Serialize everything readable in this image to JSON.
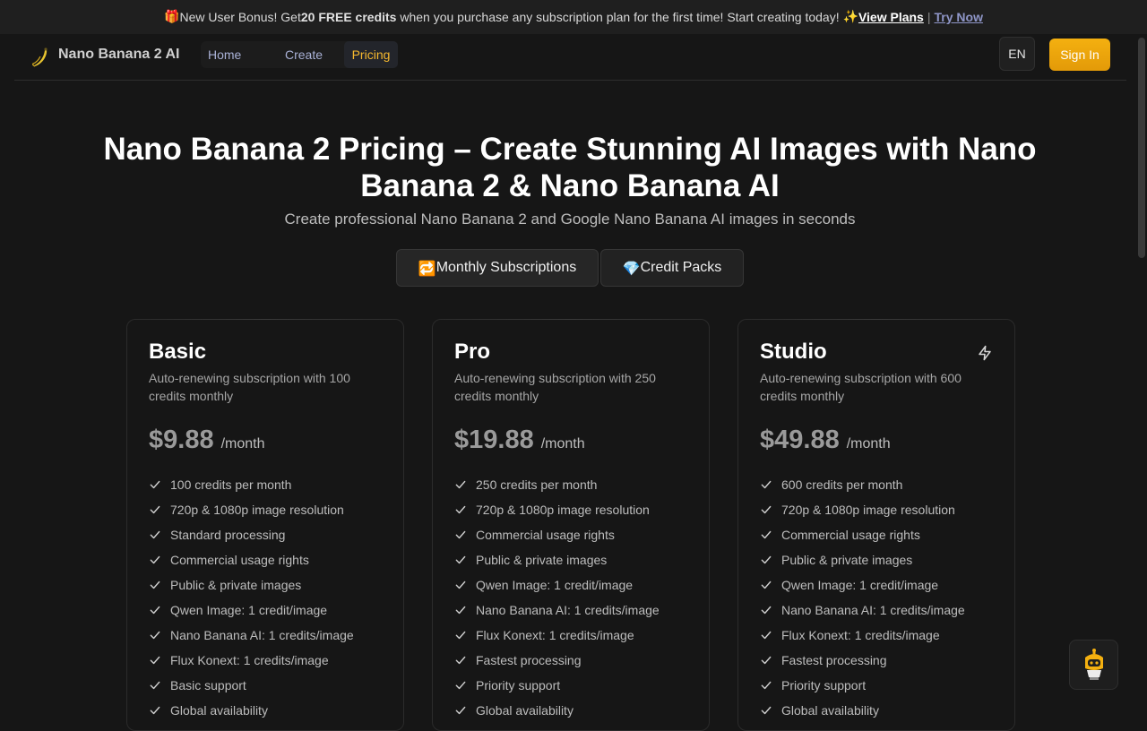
{
  "banner": {
    "gift_emoji": "🎁",
    "text_before": "New User Bonus! Get ",
    "bold_credits": "20 FREE credits",
    "text_after": " when you purchase any subscription plan for the first time! Start creating today! ",
    "sparkle_emoji": "✨",
    "view_plans": "View Plans",
    "separator": "|",
    "try_now": "Try Now"
  },
  "nav": {
    "brand": "Nano Banana 2 AI",
    "items": [
      {
        "label": "Home",
        "active": false
      },
      {
        "label": "Create",
        "active": false
      },
      {
        "label": "Pricing",
        "active": true
      }
    ],
    "lang": "EN",
    "signin": "Sign In"
  },
  "hero": {
    "title": "Nano Banana 2 Pricing – Create Stunning AI Images with Nano Banana 2 & Nano Banana AI",
    "subtitle": "Create professional Nano Banana 2 and Google Nano Banana AI images in seconds"
  },
  "tabs": [
    {
      "emoji": "🔁",
      "label": "Monthly Subscriptions",
      "active": true
    },
    {
      "emoji": "💎",
      "label": "Credit Packs",
      "active": false
    }
  ],
  "plans": [
    {
      "name": "Basic",
      "desc": "Auto-renewing subscription with 100 credits monthly",
      "price": "$9.88",
      "period": "/month",
      "features": [
        "100 credits per month",
        "720p & 1080p image resolution",
        "Standard processing",
        "Commercial usage rights",
        "Public & private images",
        "Qwen Image: 1 credit/image",
        "Nano Banana AI: 1 credits/image",
        "Flux Konext: 1 credits/image",
        "Basic support",
        "Global availability"
      ]
    },
    {
      "name": "Pro",
      "desc": "Auto-renewing subscription with 250 credits monthly",
      "price": "$19.88",
      "period": "/month",
      "features": [
        "250 credits per month",
        "720p & 1080p image resolution",
        "Commercial usage rights",
        "Public & private images",
        "Qwen Image: 1 credit/image",
        "Nano Banana AI: 1 credits/image",
        "Flux Konext: 1 credits/image",
        "Fastest processing",
        "Priority support",
        "Global availability"
      ]
    },
    {
      "name": "Studio",
      "desc": "Auto-renewing subscription with 600 credits monthly",
      "price": "$49.88",
      "period": "/month",
      "features": [
        "600 credits per month",
        "720p & 1080p image resolution",
        "Commercial usage rights",
        "Public & private images",
        "Qwen Image: 1 credit/image",
        "Nano Banana AI: 1 credits/image",
        "Flux Konext: 1 credits/image",
        "Fastest processing",
        "Priority support",
        "Global availability"
      ]
    }
  ],
  "icons": {
    "logo": "banana-logo-icon",
    "check": "check-icon",
    "studio_badge": "lightning-icon",
    "chat": "robot-chat-icon"
  },
  "colors": {
    "accent": "#f5b82e",
    "signin_bg": "#ec9f0a",
    "nav_link": "#a9b1d6",
    "background": "#161616"
  }
}
